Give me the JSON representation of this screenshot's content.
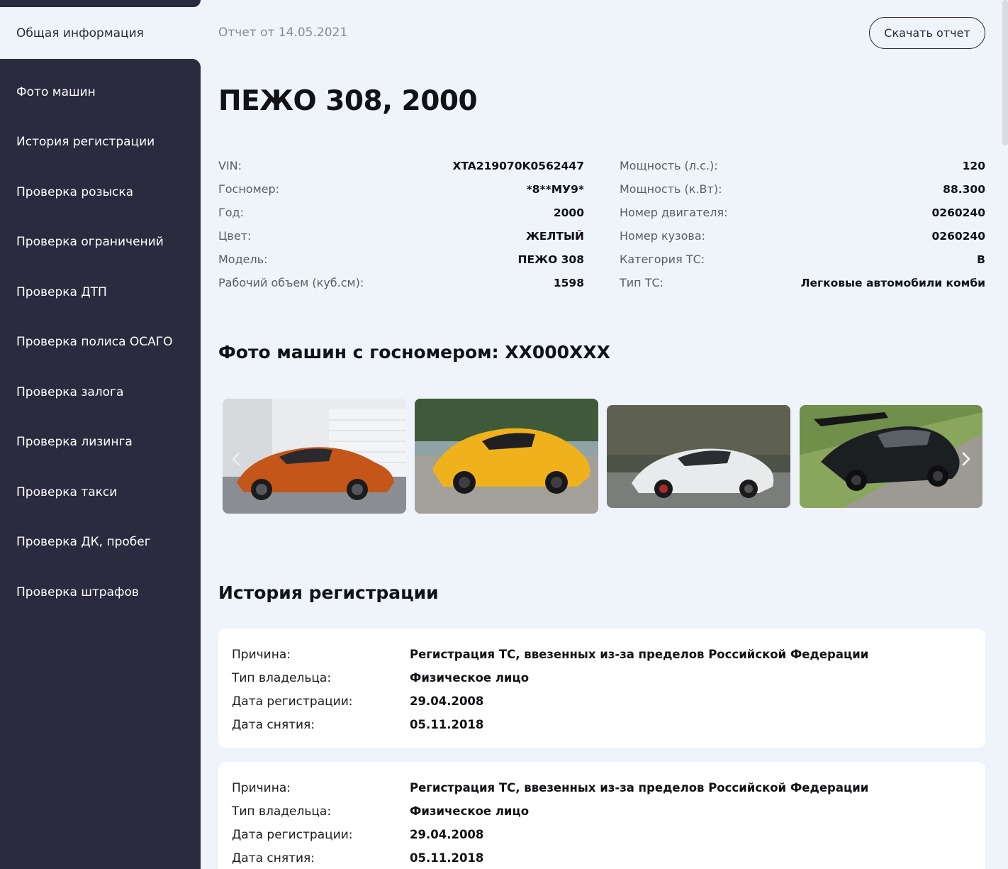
{
  "sidebar": {
    "active_item": "Общая информация",
    "items": [
      "Фото машин",
      "История регистрации",
      "Проверка розыска",
      "Проверка ограничений",
      "Проверка ДТП",
      "Проверка полиса ОСАГО",
      "Проверка залога",
      "Проверка лизинга",
      "Проверка такси",
      "Проверка ДК, пробег",
      "Проверка штрафов"
    ]
  },
  "header": {
    "report_date": "Отчет от 14.05.2021",
    "download_label": "Скачать отчет"
  },
  "car": {
    "title": "ПЕЖО 308, 2000",
    "specs_left": [
      {
        "label": "VIN:",
        "value": "XTA219070K0562447"
      },
      {
        "label": "Госномер:",
        "value": "*8**МУ9*"
      },
      {
        "label": "Год:",
        "value": "2000"
      },
      {
        "label": "Цвет:",
        "value": "ЖЕЛТЫЙ"
      },
      {
        "label": "Модель:",
        "value": "ПЕЖО 308"
      },
      {
        "label": "Рабочий объем (куб.см):",
        "value": "1598"
      }
    ],
    "specs_right": [
      {
        "label": "Мощность (л.с.):",
        "value": "120"
      },
      {
        "label": "Мощность (к.Вт):",
        "value": "88.300"
      },
      {
        "label": "Номер двигателя:",
        "value": "0260240"
      },
      {
        "label": "Номер кузова:",
        "value": "0260240"
      },
      {
        "label": "Категория ТС:",
        "value": "B"
      },
      {
        "label": "Тип ТС:",
        "value": "Легковые автомобили комби"
      }
    ]
  },
  "photos": {
    "title": "Фото машин с госномером: XX000XXX",
    "items": [
      {
        "icon": "orange-sports-car-photo",
        "color": "#c4561a"
      },
      {
        "icon": "yellow-sports-car-photo",
        "color": "#f0b21c"
      },
      {
        "icon": "white-sports-car-photo",
        "color": "#e8eaec"
      },
      {
        "icon": "black-sports-car-photo",
        "color": "#1c1f22"
      }
    ]
  },
  "history": {
    "title": "История регистрации",
    "labels": {
      "reason": "Причина:",
      "owner_type": "Тип владельца:",
      "reg_date": "Дата регистрации:",
      "dereg_date": "Дата снятия:"
    },
    "records": [
      {
        "reason": "Регистрация ТС, ввезенных из-за пределов Российской Федерации",
        "owner_type": "Физическое лицо",
        "reg_date": "29.04.2008",
        "dereg_date": "05.11.2018"
      },
      {
        "reason": "Регистрация ТС, ввезенных из-за пределов Российской Федерации",
        "owner_type": "Физическое лицо",
        "reg_date": "29.04.2008",
        "dereg_date": "05.11.2018"
      }
    ]
  },
  "colors": {
    "sidebar_bg": "#2b2a3e",
    "page_bg": "#eff3fa",
    "card_bg": "#ffffff"
  }
}
